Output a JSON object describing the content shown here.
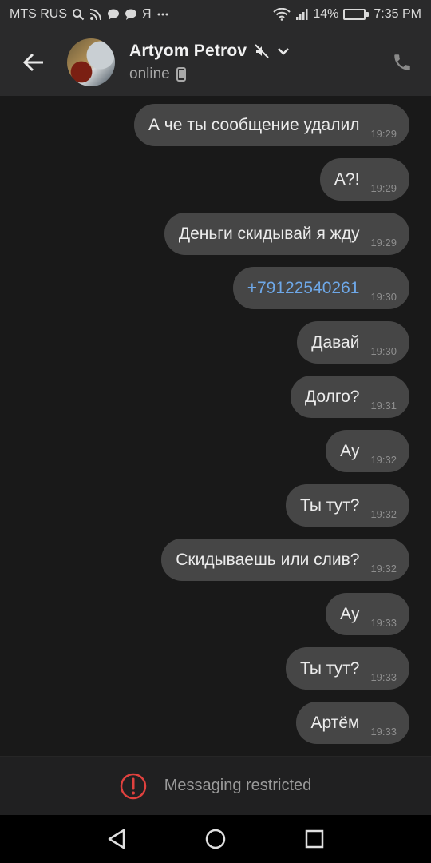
{
  "status_bar": {
    "carrier": "MTS RUS",
    "notification_icons": [
      "search-icon",
      "rss-icon",
      "chat-bubble-icon",
      "chat-bubble-icon",
      "yandex-icon",
      "more-dots-icon"
    ],
    "yandex_glyph": "Я",
    "battery": "14%",
    "time": "7:35 PM",
    "battery_level": 0.14,
    "battery_color": "#e7b02d"
  },
  "header": {
    "name": "Artyom Petrov",
    "status": "online",
    "muted": true
  },
  "messages": [
    {
      "text": "А че ты сообщение удалил",
      "time": "19:29"
    },
    {
      "text": "А?!",
      "time": "19:29"
    },
    {
      "text": "Деньги скидывай я жду",
      "time": "19:29"
    },
    {
      "text": "+79122540261",
      "time": "19:30",
      "link": true
    },
    {
      "text": "Давай",
      "time": "19:30"
    },
    {
      "text": "Долго?",
      "time": "19:31"
    },
    {
      "text": "Ау",
      "time": "19:32"
    },
    {
      "text": "Ты тут?",
      "time": "19:32"
    },
    {
      "text": "Скидываешь или слив?",
      "time": "19:32"
    },
    {
      "text": "Ау",
      "time": "19:33"
    },
    {
      "text": "Ты тут?",
      "time": "19:33"
    },
    {
      "text": "Артём",
      "time": "19:33"
    }
  ],
  "restricted": {
    "label": "Messaging restricted",
    "icon": "alert-circle-icon",
    "icon_color": "#e0413e"
  },
  "colors": {
    "background": "#191919",
    "bubble": "#464646",
    "link": "#6ea8e8",
    "header": "#2a2a2b"
  }
}
